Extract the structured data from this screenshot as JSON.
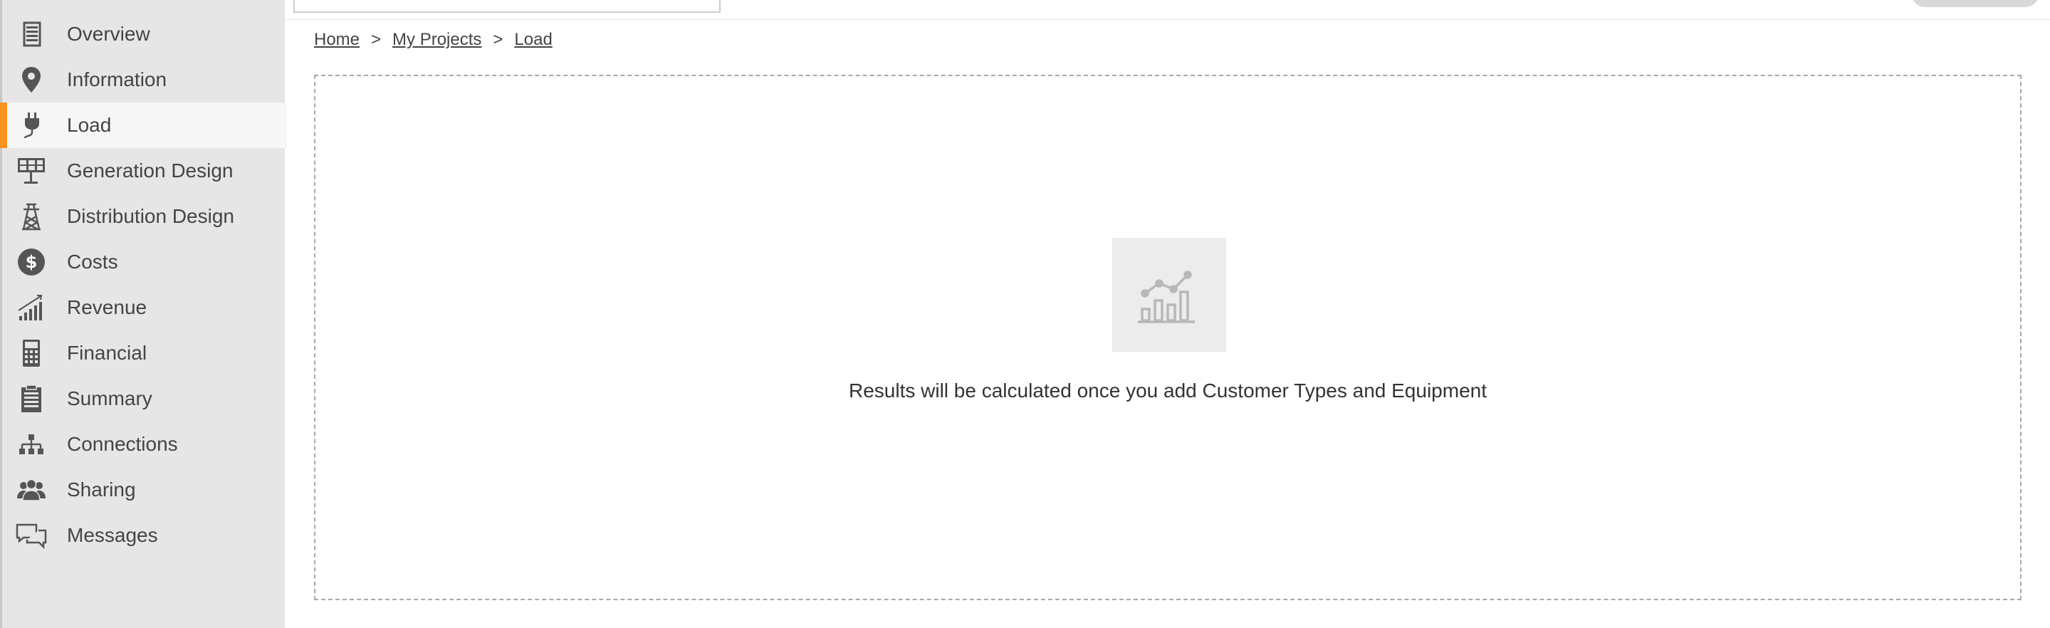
{
  "sidebar": {
    "items": [
      {
        "label": "Overview",
        "icon": "overview-icon"
      },
      {
        "label": "Information",
        "icon": "map-pin-icon"
      },
      {
        "label": "Load",
        "icon": "plug-icon",
        "active": true
      },
      {
        "label": "Generation Design",
        "icon": "solar-panel-icon"
      },
      {
        "label": "Distribution Design",
        "icon": "transmission-tower-icon"
      },
      {
        "label": "Costs",
        "icon": "dollar-icon"
      },
      {
        "label": "Revenue",
        "icon": "revenue-chart-icon"
      },
      {
        "label": "Financial",
        "icon": "calculator-icon"
      },
      {
        "label": "Summary",
        "icon": "clipboard-icon"
      },
      {
        "label": "Connections",
        "icon": "hierarchy-icon"
      },
      {
        "label": "Sharing",
        "icon": "users-icon"
      },
      {
        "label": "Messages",
        "icon": "chat-bubbles-icon"
      }
    ],
    "accent_color": "#f7931e"
  },
  "breadcrumb": {
    "items": [
      "Home",
      "My Projects",
      "Load"
    ],
    "separator": ">"
  },
  "results": {
    "message": "Results will be calculated once you add Customer Types and Equipment",
    "icon": "chart-placeholder-icon"
  }
}
